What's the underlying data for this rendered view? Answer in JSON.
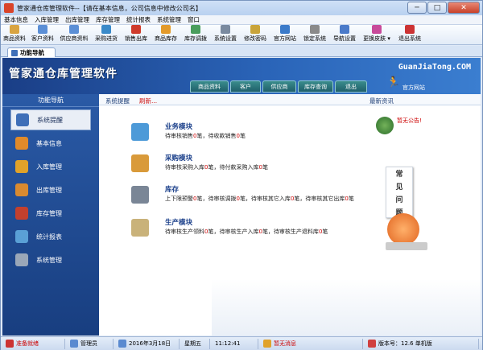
{
  "window": {
    "title": "管家通仓库管理软件--【请在基本信息，公司信息中修改公司名】",
    "min": "─",
    "max": "□",
    "close": "✕"
  },
  "menu": [
    "基本信息",
    "入库管理",
    "出库管理",
    "库存管理",
    "统计报表",
    "系统管理",
    "窗口"
  ],
  "toolbar": [
    {
      "label": "商品资料",
      "color": "#d9a441"
    },
    {
      "label": "客户资料",
      "color": "#5b8fd6"
    },
    {
      "label": "供应商资料",
      "color": "#5b8fd6"
    },
    {
      "label": "采购进货",
      "color": "#3a8ac9"
    },
    {
      "label": "销售出库",
      "color": "#cf3b2b"
    },
    {
      "label": "商品库存",
      "color": "#e39a2a"
    },
    {
      "label": "库存调拨",
      "color": "#4a9d5c"
    },
    {
      "label": "系统设置",
      "color": "#7a8a9f"
    },
    {
      "label": "修改密码",
      "color": "#c9a43a"
    },
    {
      "label": "官方网站",
      "color": "#3a7ac9"
    },
    {
      "label": "锁定系统",
      "color": "#8a8a8a"
    },
    {
      "label": "导航设置",
      "color": "#4a7ac9"
    },
    {
      "label": "更换皮肤 ▾",
      "color": "#c84a9a"
    },
    {
      "label": "退出系统",
      "color": "#c33"
    }
  ],
  "tab": {
    "label": "功能导航"
  },
  "banner": {
    "logo": "管家通仓库管理软件",
    "site": "GuanJiaTong.COM",
    "tabs": [
      "商品资料",
      "客户",
      "供应商",
      "库存查询",
      "退出"
    ],
    "official": "官方网站"
  },
  "sidebar": {
    "title": "功能导航",
    "items": [
      {
        "label": "系统提醒",
        "color": "#3f6fb8",
        "active": true
      },
      {
        "label": "基本信息",
        "color": "#e08a2a",
        "active": false
      },
      {
        "label": "入库管理",
        "color": "#e0a22a",
        "active": false
      },
      {
        "label": "出库管理",
        "color": "#d98a30",
        "active": false
      },
      {
        "label": "库存管理",
        "color": "#c3402e",
        "active": false
      },
      {
        "label": "统计报表",
        "color": "#5aa0d6",
        "active": false
      },
      {
        "label": "系统管理",
        "color": "#9aa7b8",
        "active": false
      }
    ]
  },
  "main": {
    "header": {
      "reminder": "系统提醒",
      "refresh": "刷新...",
      "news": "最新资讯"
    },
    "modules": [
      {
        "title": "业务模块",
        "color": "#4d9ad8",
        "parts": [
          "待审核销售",
          "0",
          "笔，待收款销售",
          "0",
          "笔"
        ]
      },
      {
        "title": "采购模块",
        "color": "#d99a3a",
        "parts": [
          "待审核采购入库",
          "0",
          "笔，待付款采购入库",
          "0",
          "笔"
        ]
      },
      {
        "title": "库存",
        "color": "#7a8696",
        "parts": [
          "上下限预警",
          "0",
          "笔，待审核调拨",
          "0",
          "笔，待审核其它入库",
          "0",
          "笔，待审核其它出库",
          "0",
          "笔"
        ]
      },
      {
        "title": "生产模块",
        "color": "#c9b27a",
        "parts": [
          "待审核生产领料",
          "0",
          "笔，待审核生产入库",
          "0",
          "笔，待审核生产退料库",
          "0",
          "笔"
        ]
      }
    ],
    "notice": "暂无公告!",
    "faq": [
      "常",
      "见",
      "问",
      "题"
    ]
  },
  "status": [
    {
      "text": "准备就绪",
      "red": true,
      "color": "#c33"
    },
    {
      "text": "管理员",
      "red": false,
      "color": "#5a8ad0"
    },
    {
      "text": "2016年3月18日",
      "red": false,
      "color": "#5a8ad0"
    },
    {
      "text": "星期五",
      "red": false,
      "color": ""
    },
    {
      "text": "11:12:41",
      "red": false,
      "color": ""
    },
    {
      "text": "暂无消息",
      "red": true,
      "color": "#e0a22a"
    },
    {
      "text": "版本号：12.6 单机版",
      "red": false,
      "color": "#d04040"
    }
  ]
}
